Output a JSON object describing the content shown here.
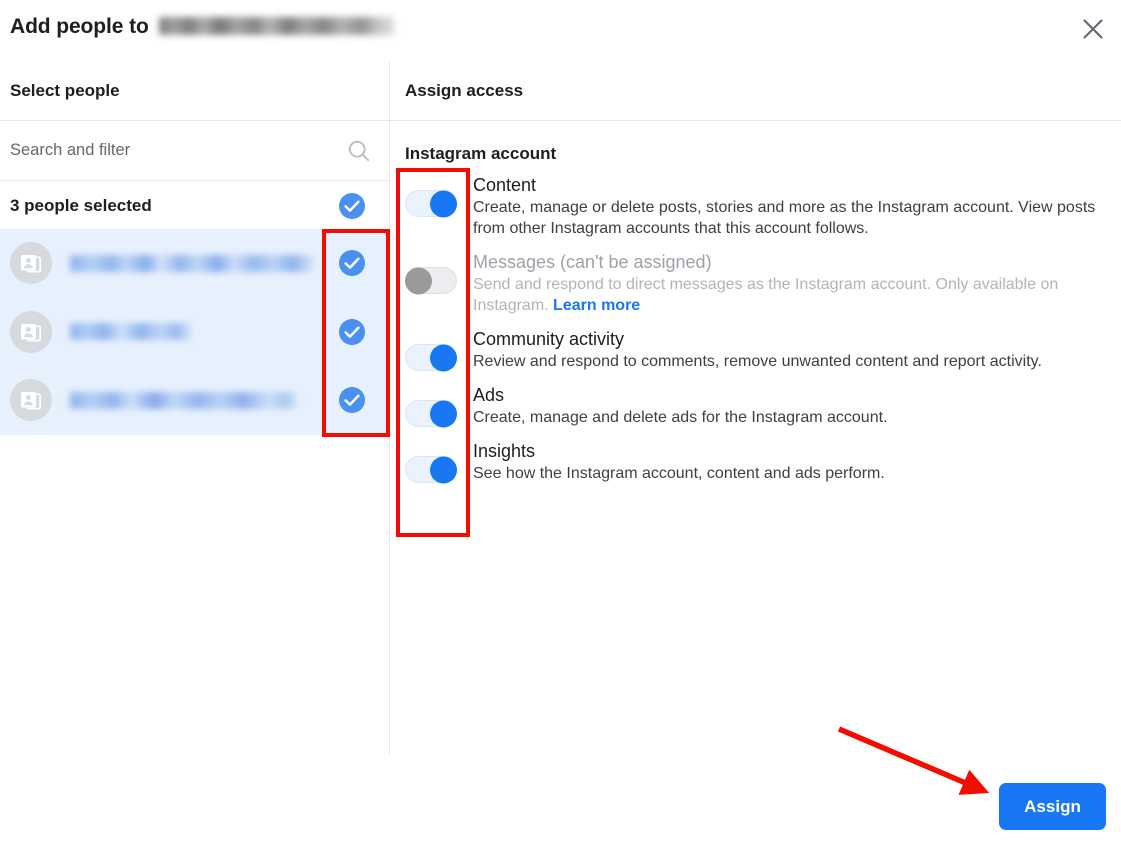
{
  "dialog": {
    "title_prefix": "Add people to",
    "title_target_redacted": "",
    "close_icon": "close-icon"
  },
  "left_pane": {
    "heading": "Select people",
    "search": {
      "placeholder": "Search and filter",
      "value": "",
      "icon": "search-icon"
    },
    "selected_summary": {
      "label": "3 people selected",
      "checked": true,
      "icon": "check-circle-icon"
    },
    "people": [
      {
        "name_redacted": "",
        "selected": true,
        "avatar_icon": "contact-card-icon"
      },
      {
        "name_redacted": "",
        "selected": true,
        "avatar_icon": "contact-card-icon"
      },
      {
        "name_redacted": "",
        "selected": true,
        "avatar_icon": "contact-card-icon"
      }
    ]
  },
  "right_pane": {
    "heading": "Assign access",
    "section_title": "Instagram account",
    "permissions": [
      {
        "title": "Content",
        "description": "Create, manage or delete posts, stories and more as the Instagram account. View posts from other Instagram accounts that this account follows.",
        "enabled": true,
        "disabled": false,
        "link_label": ""
      },
      {
        "title": "Messages (can't be assigned)",
        "description": "Send and respond to direct messages as the Instagram account. Only available on Instagram.",
        "enabled": false,
        "disabled": true,
        "link_label": "Learn more"
      },
      {
        "title": "Community activity",
        "description": "Review and respond to comments, remove unwanted content and report activity.",
        "enabled": true,
        "disabled": false,
        "link_label": ""
      },
      {
        "title": "Ads",
        "description": "Create, manage and delete ads for the Instagram account.",
        "enabled": true,
        "disabled": false,
        "link_label": ""
      },
      {
        "title": "Insights",
        "description": "See how the Instagram account, content and ads perform.",
        "enabled": true,
        "disabled": false,
        "link_label": ""
      }
    ]
  },
  "footer": {
    "assign_label": "Assign"
  },
  "annotations": {
    "color": "#f30d00",
    "highlight_checkbox_column": true,
    "highlight_toggle_column": true,
    "arrow_points_to": "Assign"
  },
  "colors": {
    "accent_blue": "#1877f2",
    "selected_row_bg": "#e7f0fd",
    "text_primary": "#1c1e21",
    "text_secondary": "#65676b",
    "disabled_text": "#9ea2a8",
    "annotation_red": "#f30d00"
  }
}
